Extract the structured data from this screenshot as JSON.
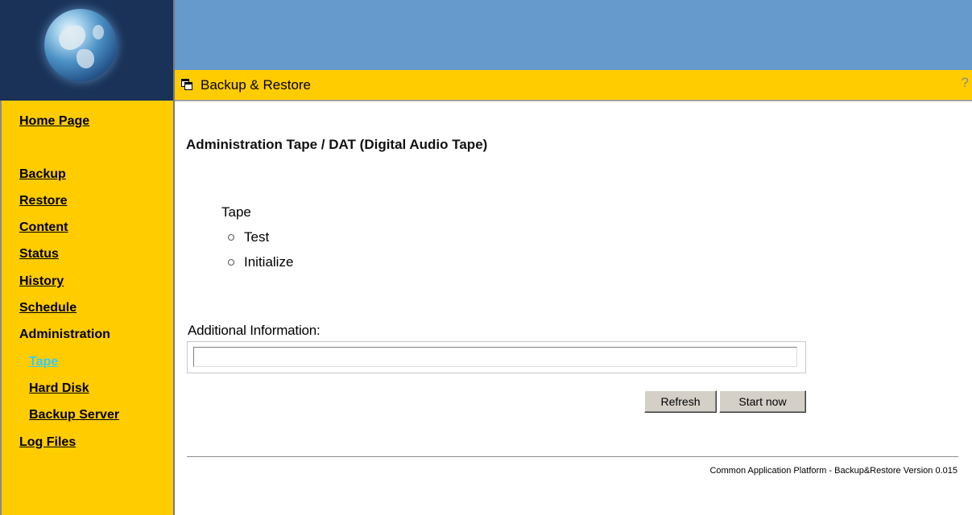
{
  "header": {
    "title": "Backup & Restore",
    "help_symbol": "?"
  },
  "sidebar": {
    "items": [
      {
        "label": "Home Page",
        "active": false,
        "link": true
      },
      {
        "label": "Backup",
        "active": false,
        "link": true
      },
      {
        "label": "Restore",
        "active": false,
        "link": true
      },
      {
        "label": "Content",
        "active": false,
        "link": true
      },
      {
        "label": "Status",
        "active": false,
        "link": true
      },
      {
        "label": "History",
        "active": false,
        "link": true
      },
      {
        "label": "Schedule",
        "active": false,
        "link": true
      },
      {
        "label": "Administration",
        "active": false,
        "link": false
      },
      {
        "label": "Tape",
        "active": true,
        "link": true
      },
      {
        "label": "Hard Disk",
        "active": false,
        "link": true
      },
      {
        "label": "Backup Server",
        "active": false,
        "link": true
      },
      {
        "label": "Log Files",
        "active": false,
        "link": true
      }
    ]
  },
  "main": {
    "heading": "Administration Tape / DAT (Digital Audio Tape)",
    "tape_group": {
      "label": "Tape",
      "options": [
        {
          "label": "Test",
          "selected": false
        },
        {
          "label": "Initialize",
          "selected": false
        }
      ]
    },
    "additional_info": {
      "label": "Additional Information:",
      "value": ""
    },
    "buttons": {
      "refresh": "Refresh",
      "start_now": "Start now"
    },
    "footer": "Common Application Platform - Backup&Restore Version 0.015"
  },
  "colors": {
    "sidebar_bg": "#ffcc00",
    "header_blue": "#6699cc",
    "logo_bg": "#1a3258",
    "active_link": "#33ccff"
  },
  "icons": {
    "logo": "globe-icon",
    "title": "window-icon",
    "help": "help-icon"
  }
}
